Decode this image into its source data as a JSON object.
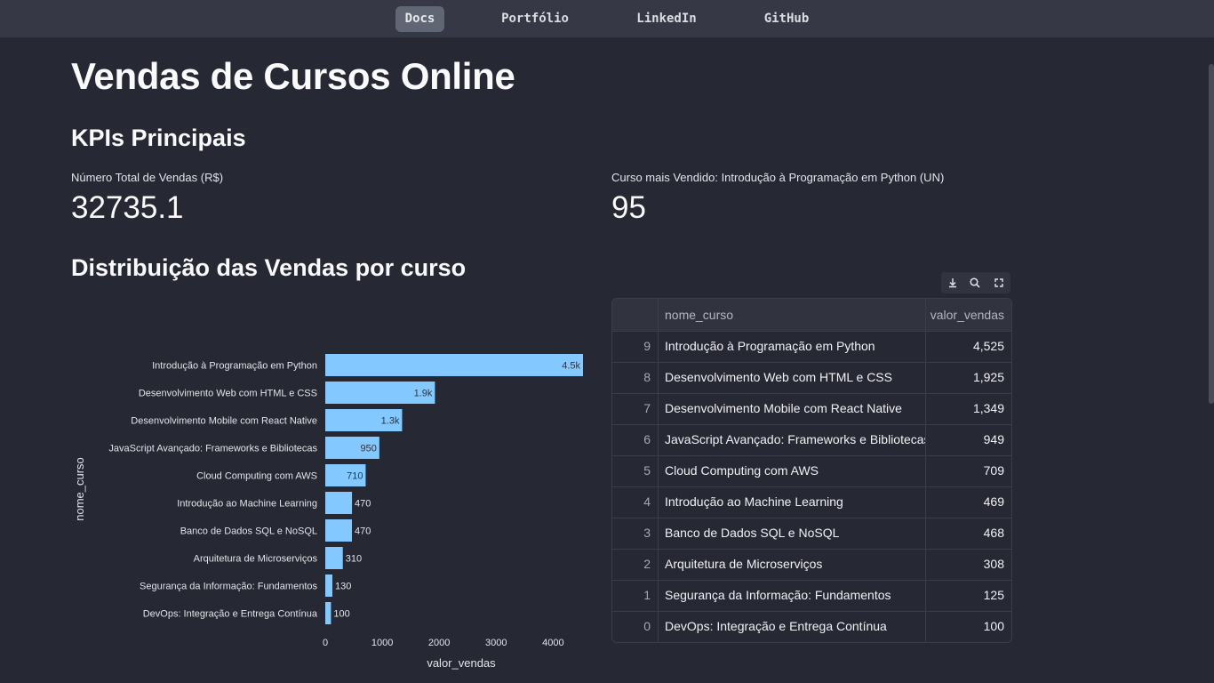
{
  "nav": {
    "items": [
      {
        "label": "Docs",
        "active": true
      },
      {
        "label": "Portfólio",
        "active": false
      },
      {
        "label": "LinkedIn",
        "active": false
      },
      {
        "label": "GitHub",
        "active": false
      }
    ]
  },
  "page": {
    "title": "Vendas de Cursos Online",
    "kpi_heading": "KPIs Principais",
    "dist_heading": "Distribuição das Vendas por curso"
  },
  "kpis": [
    {
      "label": "Número Total de Vendas (R$)",
      "value": "32735.1"
    },
    {
      "label": "Curso mais Vendido: Introdução à Programação em Python (UN)",
      "value": "95"
    }
  ],
  "toolbar": {
    "icons": [
      "download-icon",
      "search-icon",
      "fullscreen-icon"
    ]
  },
  "table": {
    "headers": [
      "",
      "nome_curso",
      "valor_vendas"
    ],
    "rows": [
      {
        "idx": "9",
        "nome_curso": "Introdução à Programação em Python",
        "valor_vendas": "4,525"
      },
      {
        "idx": "8",
        "nome_curso": "Desenvolvimento Web com HTML e CSS",
        "valor_vendas": "1,925"
      },
      {
        "idx": "7",
        "nome_curso": "Desenvolvimento Mobile com React Native",
        "valor_vendas": "1,349"
      },
      {
        "idx": "6",
        "nome_curso": "JavaScript Avançado: Frameworks e Bibliotecas",
        "valor_vendas": "949"
      },
      {
        "idx": "5",
        "nome_curso": "Cloud Computing com AWS",
        "valor_vendas": "709"
      },
      {
        "idx": "4",
        "nome_curso": "Introdução ao Machine Learning",
        "valor_vendas": "469"
      },
      {
        "idx": "3",
        "nome_curso": "Banco de Dados SQL e NoSQL",
        "valor_vendas": "468"
      },
      {
        "idx": "2",
        "nome_curso": "Arquitetura de Microserviços",
        "valor_vendas": "308"
      },
      {
        "idx": "1",
        "nome_curso": "Segurança da Informação: Fundamentos",
        "valor_vendas": "125"
      },
      {
        "idx": "0",
        "nome_curso": "DevOps: Integração e Entrega Contínua",
        "valor_vendas": "100"
      }
    ]
  },
  "colors": {
    "bar": "#83c9ff",
    "background": "#262833",
    "nav_bg": "#363945"
  },
  "chart_data": {
    "type": "bar",
    "orientation": "horizontal",
    "categories": [
      "Introdução à Programação em Python",
      "Desenvolvimento Web com HTML e CSS",
      "Desenvolvimento Mobile com React Native",
      "JavaScript Avançado: Frameworks e Bibliotecas",
      "Cloud Computing com AWS",
      "Introdução ao Machine Learning",
      "Banco de Dados SQL e NoSQL",
      "Arquitetura de Microserviços",
      "Segurança da Informação: Fundamentos",
      "DevOps: Integração e Entrega Contínua"
    ],
    "values": [
      4525,
      1925,
      1349,
      949,
      709,
      469,
      468,
      308,
      125,
      100
    ],
    "data_labels": [
      "4.5k",
      "1.9k",
      "1.3k",
      "950",
      "710",
      "470",
      "470",
      "310",
      "130",
      "100"
    ],
    "xlabel": "valor_vendas",
    "ylabel": "nome_curso",
    "xlim": [
      0,
      4525
    ],
    "xticks": [
      0,
      1000,
      2000,
      3000,
      4000
    ],
    "grid": false
  }
}
